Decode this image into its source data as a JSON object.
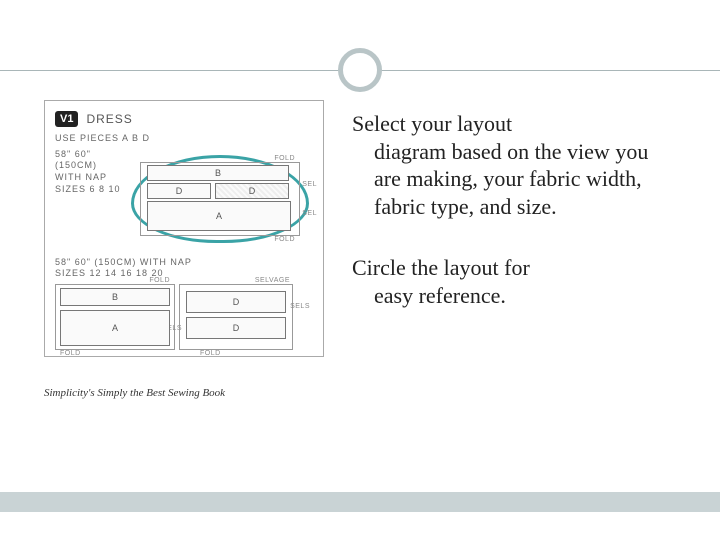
{
  "rule": {
    "circle": true
  },
  "figure": {
    "view_badge": "V1",
    "view_label": "DRESS",
    "use_pieces": "USE PIECES  A B D",
    "block1": {
      "width_line": "58\" 60\" (150CM)",
      "nap_line": "WITH NAP",
      "sizes_line": "SIZES 6 8 10",
      "labels": {
        "fold": "FOLD",
        "sel": "SEL",
        "B": "B",
        "D_left": "D",
        "D_right": "D",
        "A": "A"
      },
      "circled": true
    },
    "block2": {
      "width_line": "58\" 60\" (150CM)  WITH NAP",
      "sizes_line": "SIZES 12 14 16 18 20",
      "labels": {
        "fold": "FOLD",
        "sel": "SELS",
        "selvage": "SELVAGE",
        "B": "B",
        "D": "D",
        "A": "A"
      }
    },
    "source": "Simplicity's Simply the Best Sewing Book"
  },
  "body": {
    "p1_first": "Select your layout",
    "p1_rest": "diagram based on the view you are making, your fabric width, fabric type, and size.",
    "p2_first": "Circle the layout for",
    "p2_rest": "easy reference."
  }
}
